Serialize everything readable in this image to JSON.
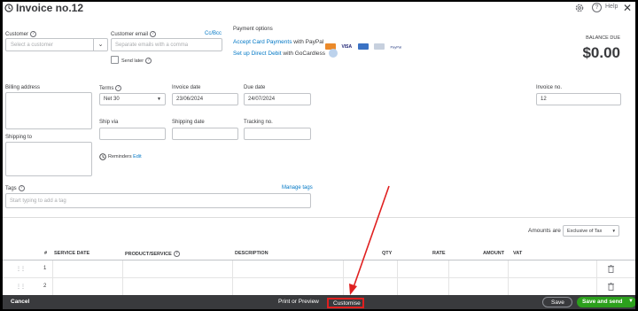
{
  "header": {
    "title": "Invoice no.12",
    "help_label": "Help"
  },
  "customer": {
    "label": "Customer",
    "placeholder": "Select a customer"
  },
  "email": {
    "label": "Customer email",
    "placeholder": "Separate emails with a comma",
    "ccbcc": "Cc/Bcc",
    "send_later": "Send later"
  },
  "payment": {
    "label": "Payment options",
    "card_link": "Accept Card Payments",
    "card_suffix": " with PayPal",
    "debit_link": "Set up Direct Debit",
    "debit_suffix": " with GoCardless",
    "cards": [
      "VISA",
      "PayPal"
    ]
  },
  "balance": {
    "label": "BALANCE DUE",
    "value": "$0.00"
  },
  "billing": {
    "label": "Billing address"
  },
  "shipping": {
    "label": "Shipping to"
  },
  "terms": {
    "label": "Terms",
    "value": "Net 30"
  },
  "invoice_date": {
    "label": "Invoice date",
    "value": "23/06/2024"
  },
  "due_date": {
    "label": "Due date",
    "value": "24/07/2024"
  },
  "invoice_no": {
    "label": "Invoice no.",
    "value": "12"
  },
  "ship_via": {
    "label": "Ship via"
  },
  "shipping_date": {
    "label": "Shipping date"
  },
  "tracking": {
    "label": "Tracking no."
  },
  "reminders": {
    "label": "Reminders",
    "edit": "Edit"
  },
  "tags": {
    "label": "Tags",
    "manage": "Manage tags",
    "placeholder": "Start typing to add a tag"
  },
  "amounts": {
    "label": "Amounts are",
    "value": "Exclusive of Tax"
  },
  "table": {
    "columns": [
      "#",
      "SERVICE DATE",
      "PRODUCT/SERVICE",
      "DESCRIPTION",
      "QTY",
      "RATE",
      "AMOUNT",
      "VAT"
    ],
    "rows": [
      "1",
      "2"
    ]
  },
  "footer": {
    "cancel": "Cancel",
    "print": "Print or Preview",
    "customise": "Customise",
    "save": "Save",
    "save_send": "Save and send"
  }
}
